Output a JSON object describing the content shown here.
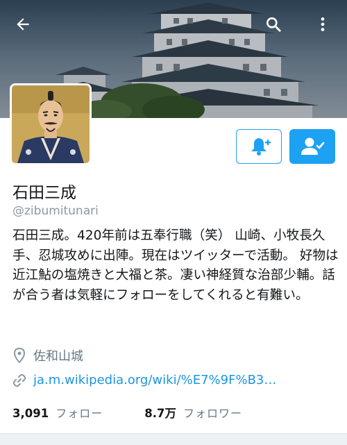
{
  "header": {
    "back_icon": "arrow-left-icon",
    "search_icon": "search-icon",
    "more_icon": "more-vertical-icon"
  },
  "profile": {
    "name": "石田三成",
    "handle": "@zibumitunari",
    "bio": "石田三成。420年前は五奉行職（笑） 山崎、小牧長久手、忍城攻めに出陣。現在はツイッターで活動。 好物は近江鮎の塩焼きと大福と茶。凄い神経質な治部少輔。話が合う者は気軽にフォローをしてくれると有難い。",
    "location": "佐和山城",
    "link": "ja.m.wikipedia.org/wiki/%E7%9F%B3…"
  },
  "stats": {
    "following_count": "3,091",
    "following_label": "フォロー",
    "followers_count": "8.7万",
    "followers_label": "フォロワー"
  },
  "colors": {
    "accent": "#1da1f2",
    "link": "#1b95e0",
    "muted": "#657786"
  }
}
